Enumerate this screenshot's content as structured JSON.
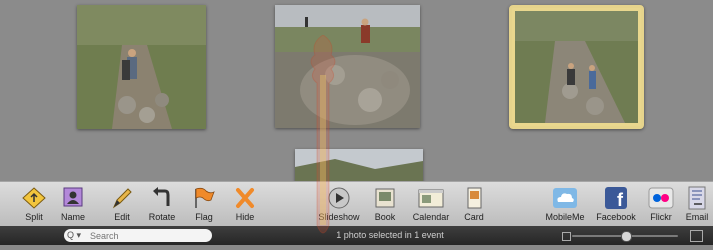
{
  "toolbar": {
    "left": [
      {
        "id": "split",
        "label": "Split",
        "icon": "split-icon"
      },
      {
        "id": "name",
        "label": "Name",
        "icon": "name-icon"
      },
      {
        "id": "edit",
        "label": "Edit",
        "icon": "pencil-icon"
      },
      {
        "id": "rotate",
        "label": "Rotate",
        "icon": "rotate-icon"
      },
      {
        "id": "flag",
        "label": "Flag",
        "icon": "flag-icon"
      },
      {
        "id": "hide",
        "label": "Hide",
        "icon": "hide-x-icon"
      }
    ],
    "center": [
      {
        "id": "slideshow",
        "label": "Slideshow",
        "icon": "play-icon"
      },
      {
        "id": "book",
        "label": "Book",
        "icon": "book-icon"
      },
      {
        "id": "calendar",
        "label": "Calendar",
        "icon": "calendar-icon"
      },
      {
        "id": "card",
        "label": "Card",
        "icon": "card-icon"
      }
    ],
    "right": [
      {
        "id": "mobileme",
        "label": "MobileMe",
        "icon": "cloud-icon"
      },
      {
        "id": "facebook",
        "label": "Facebook",
        "icon": "facebook-icon"
      },
      {
        "id": "flickr",
        "label": "Flickr",
        "icon": "flickr-icon"
      },
      {
        "id": "email",
        "label": "Email",
        "icon": "email-icon"
      }
    ]
  },
  "statusbar": {
    "search_placeholder": "Search",
    "search_icon": "Q ▾",
    "status": "1 photo selected in 1 event"
  },
  "colors": {
    "selection": "#e6d48c",
    "background": "#8b8b8b"
  }
}
